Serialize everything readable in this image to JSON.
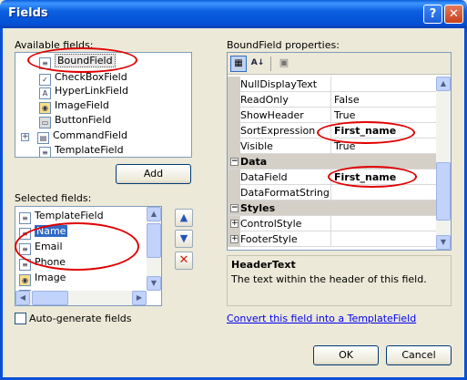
{
  "window": {
    "title": "Fields",
    "help_glyph": "?",
    "close_glyph": "✕"
  },
  "available": {
    "label": "Available fields:",
    "items": [
      {
        "label": "BoundField",
        "icon": "bound-field-icon"
      },
      {
        "label": "CheckBoxField",
        "icon": "checkbox-field-icon"
      },
      {
        "label": "HyperLinkField",
        "icon": "hyperlink-field-icon"
      },
      {
        "label": "ImageField",
        "icon": "image-field-icon"
      },
      {
        "label": "ButtonField",
        "icon": "button-field-icon"
      },
      {
        "label": "CommandField",
        "icon": "command-field-icon"
      },
      {
        "label": "TemplateField",
        "icon": "template-field-icon"
      }
    ]
  },
  "add_button": "Add",
  "selected": {
    "label": "Selected fields:",
    "items": [
      {
        "label": "TemplateField"
      },
      {
        "label": "Name"
      },
      {
        "label": "Email"
      },
      {
        "label": "Phone"
      },
      {
        "label": "Image"
      }
    ]
  },
  "autogen": {
    "label": "Auto-generate fields",
    "checked": false
  },
  "properties": {
    "label": "BoundField properties:",
    "rows": [
      {
        "name": "NullDisplayText",
        "value": ""
      },
      {
        "name": "ReadOnly",
        "value": "False"
      },
      {
        "name": "ShowHeader",
        "value": "True"
      },
      {
        "name": "SortExpression",
        "value": "First_name"
      },
      {
        "name": "Visible",
        "value": "True"
      }
    ],
    "cat_data": "Data",
    "data_rows": [
      {
        "name": "DataField",
        "value": "First_name"
      },
      {
        "name": "DataFormatString",
        "value": ""
      }
    ],
    "cat_styles": "Styles",
    "style_rows": [
      {
        "name": "ControlStyle",
        "value": ""
      },
      {
        "name": "FooterStyle",
        "value": ""
      }
    ]
  },
  "help": {
    "title": "HeaderText",
    "text": "The text within the header of this field."
  },
  "convert_link": "Convert this field into a TemplateField",
  "ok_button": "OK",
  "cancel_button": "Cancel",
  "annotation_color": "#e00000"
}
